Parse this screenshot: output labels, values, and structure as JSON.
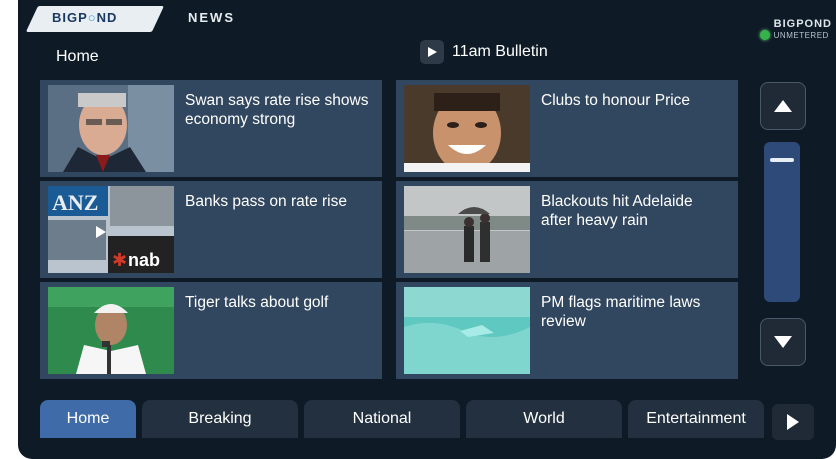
{
  "header": {
    "logo_text_a": "BIGP",
    "logo_text_b": "ND",
    "news_label": "NEWS",
    "section_title": "Home",
    "bulletin_label": "11am Bulletin",
    "status": {
      "line1": "BIGPOND",
      "line2": "UNMETERED",
      "color": "#35b24a"
    }
  },
  "stories": [
    {
      "headline": "Swan says rate rise shows economy strong",
      "thumb": "politician-photo"
    },
    {
      "headline": "Clubs to honour Price",
      "thumb": "smiling-man-photo"
    },
    {
      "headline": "Banks pass on rate rise",
      "thumb": "bank-logos-photo",
      "thumb_texts": [
        "ANZ",
        "nab"
      ]
    },
    {
      "headline": "Blackouts hit Adelaide after heavy rain",
      "thumb": "people-umbrella-photo"
    },
    {
      "headline": "Tiger talks about golf",
      "thumb": "golfer-press-photo"
    },
    {
      "headline": "PM flags maritime laws review",
      "thumb": "sea-boat-photo"
    }
  ],
  "scrollbar": {
    "up_icon": "triangle-up-icon",
    "down_icon": "triangle-down-icon"
  },
  "tabs": [
    {
      "label": "Home",
      "active": true
    },
    {
      "label": "Breaking"
    },
    {
      "label": "National"
    },
    {
      "label": "World"
    },
    {
      "label": "Entertainment"
    }
  ],
  "colors": {
    "accent": "#3f6ca8",
    "card": "#31465f",
    "background": "#0e1b27"
  }
}
